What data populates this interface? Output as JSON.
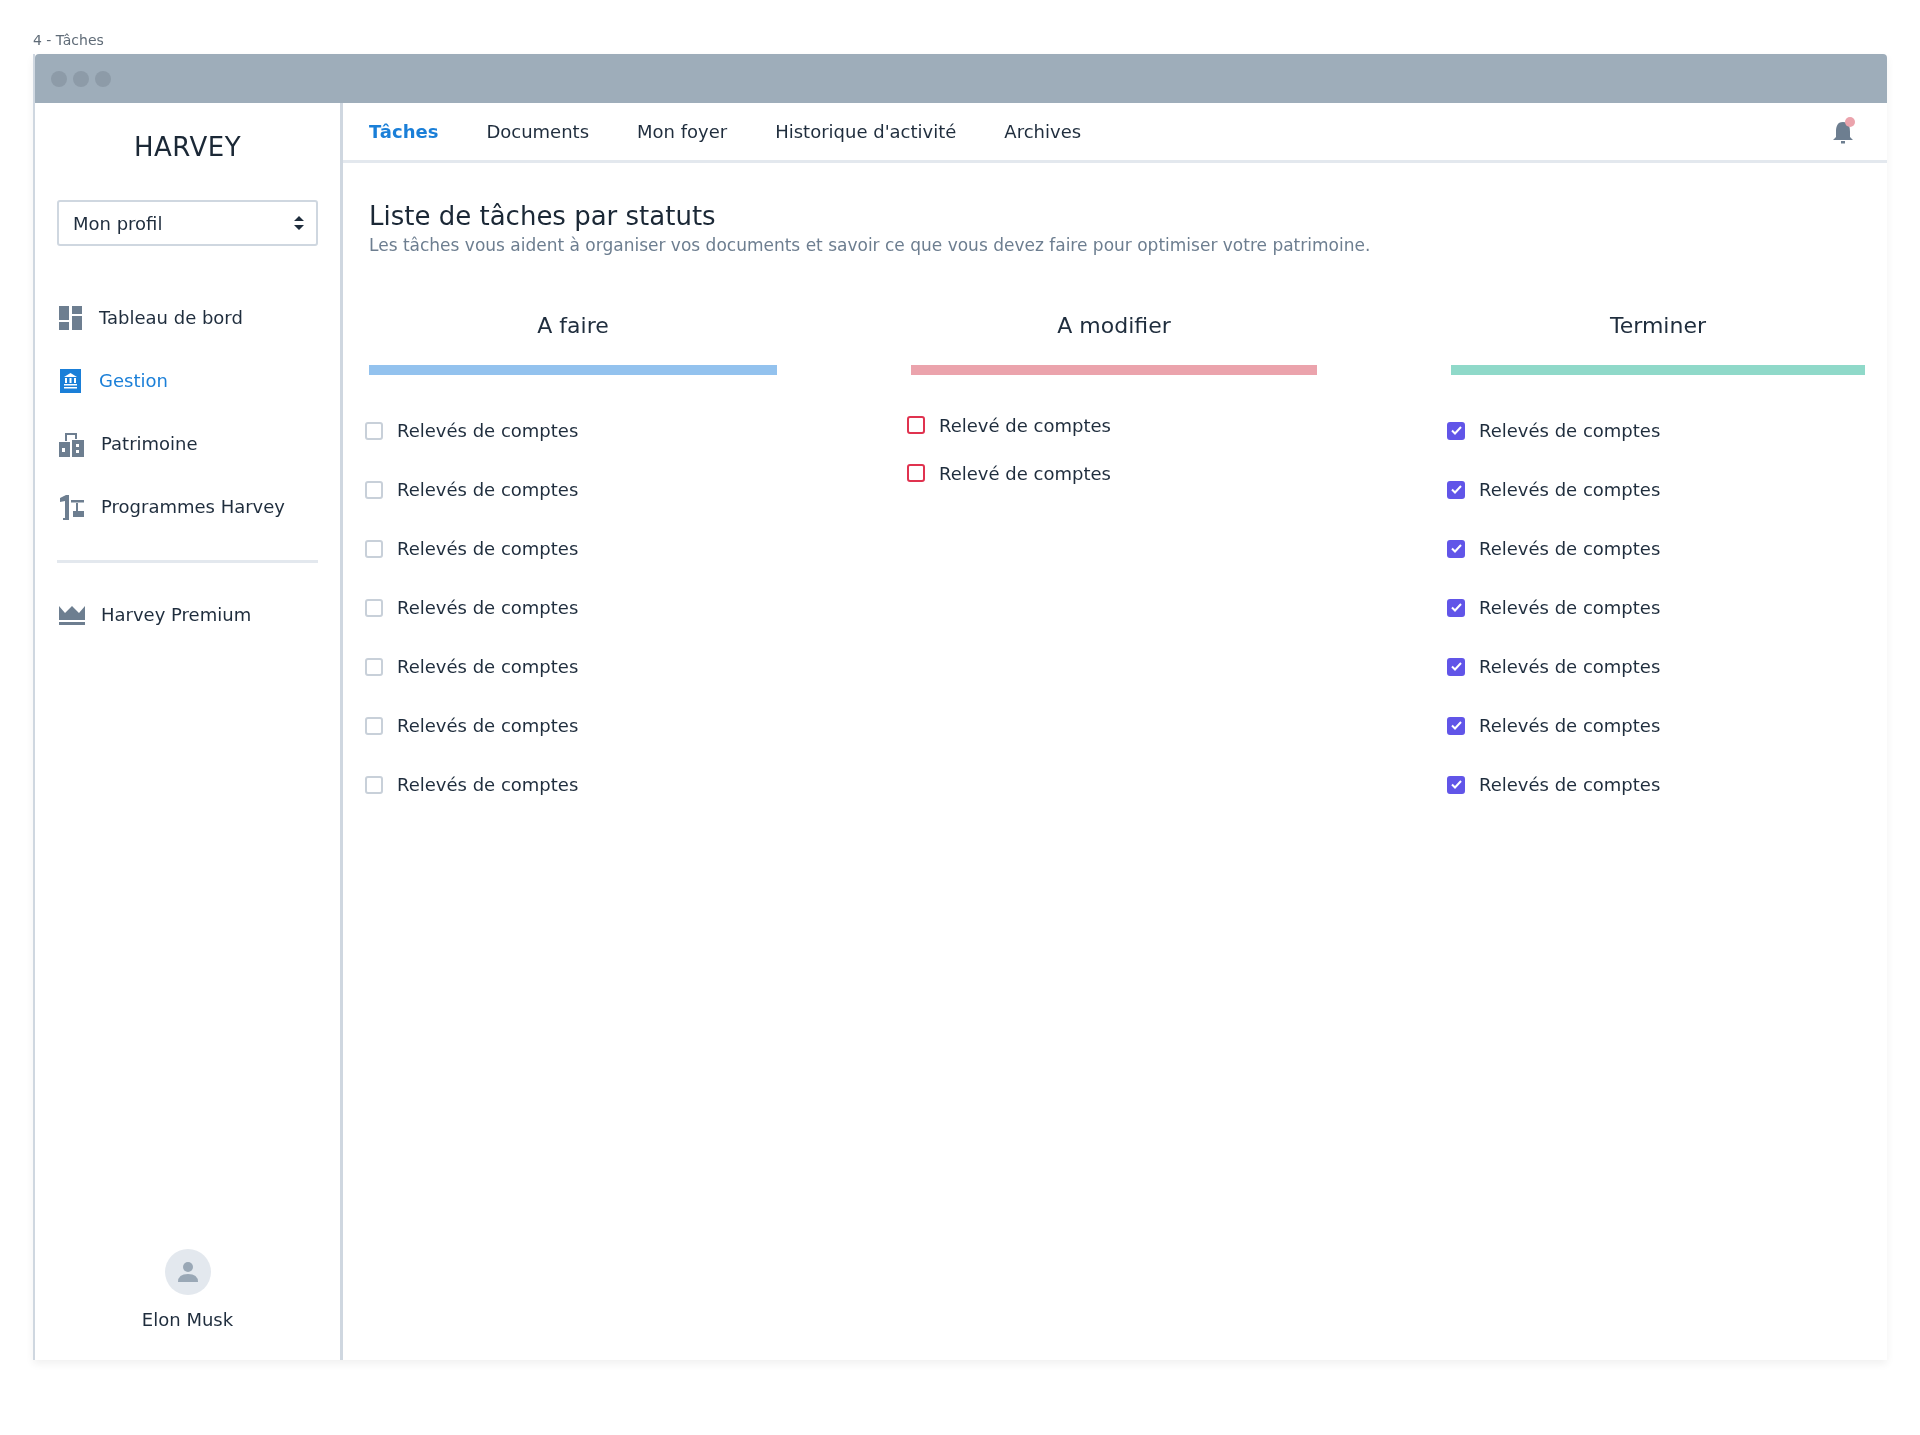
{
  "page_caption": "4 - Tâches",
  "sidebar": {
    "brand": "HARVEY",
    "profile_select": {
      "value": "Mon profil"
    },
    "items": [
      {
        "label": "Tableau de bord",
        "selected": false
      },
      {
        "label": "Gestion",
        "selected": true
      },
      {
        "label": "Patrimoine",
        "selected": false
      },
      {
        "label": "Programmes Harvey",
        "selected": false
      }
    ],
    "bottom_items": [
      {
        "label": "Harvey Premium",
        "selected": false
      }
    ],
    "user": {
      "name": "Elon Musk"
    }
  },
  "tabs": [
    {
      "label": "Tâches",
      "selected": true
    },
    {
      "label": "Documents",
      "selected": false
    },
    {
      "label": "Mon foyer",
      "selected": false
    },
    {
      "label": "Historique d'activité",
      "selected": false
    },
    {
      "label": "Archives",
      "selected": false
    }
  ],
  "notifications": {
    "unread": true
  },
  "heading": "Liste de tâches par statuts",
  "subtitle": "Les tâches vous aident à organiser vos documents et savoir ce que vous devez faire pour optimiser votre patrimoine.",
  "columns": [
    {
      "title": "A faire",
      "kind": "todo",
      "color": "#93c2ee",
      "tasks": [
        {
          "label": "Relevés de comptes",
          "checked": false
        },
        {
          "label": "Relevés de comptes",
          "checked": false
        },
        {
          "label": "Relevés de comptes",
          "checked": false
        },
        {
          "label": "Relevés de comptes",
          "checked": false
        },
        {
          "label": "Relevés de comptes",
          "checked": false
        },
        {
          "label": "Relevés de comptes",
          "checked": false
        },
        {
          "label": "Relevés de comptes",
          "checked": false
        }
      ]
    },
    {
      "title": "A modifier",
      "kind": "modify",
      "color": "#eba3ac",
      "tasks": [
        {
          "label": "Relevé de comptes",
          "checked": false
        },
        {
          "label": "Relevé de comptes",
          "checked": false
        }
      ]
    },
    {
      "title": "Terminer",
      "kind": "done",
      "color": "#8fd9c9",
      "tasks": [
        {
          "label": "Relevés de comptes",
          "checked": true
        },
        {
          "label": "Relevés de comptes",
          "checked": true
        },
        {
          "label": "Relevés de comptes",
          "checked": true
        },
        {
          "label": "Relevés de comptes",
          "checked": true
        },
        {
          "label": "Relevés de comptes",
          "checked": true
        },
        {
          "label": "Relevés de comptes",
          "checked": true
        },
        {
          "label": "Relevés de comptes",
          "checked": true
        }
      ]
    }
  ]
}
